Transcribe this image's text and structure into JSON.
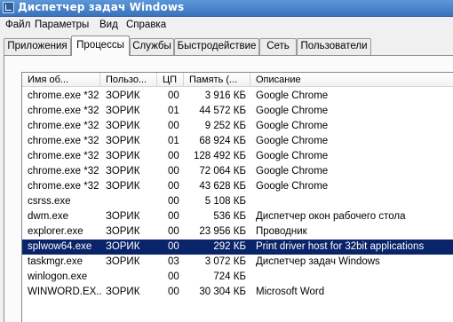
{
  "window": {
    "title": "Диспетчер задач Windows"
  },
  "menu": [
    "Файл",
    "Параметры",
    "Вид",
    "Справка"
  ],
  "tabs": [
    {
      "label": "Приложения",
      "active": false
    },
    {
      "label": "Процессы",
      "active": true
    },
    {
      "label": "Службы",
      "active": false
    },
    {
      "label": "Быстродействие",
      "active": false
    },
    {
      "label": "Сеть",
      "active": false
    },
    {
      "label": "Пользователи",
      "active": false
    }
  ],
  "columns": [
    "Имя об...",
    "Пользо...",
    "ЦП",
    "Память (...",
    "Описание"
  ],
  "processes": [
    {
      "name": "chrome.exe *32",
      "user": "ЗОРИК",
      "cpu": "00",
      "memory": "3 916 КБ",
      "desc": "Google Chrome"
    },
    {
      "name": "chrome.exe *32",
      "user": "ЗОРИК",
      "cpu": "01",
      "memory": "44 572 КБ",
      "desc": "Google Chrome"
    },
    {
      "name": "chrome.exe *32",
      "user": "ЗОРИК",
      "cpu": "00",
      "memory": "9 252 КБ",
      "desc": "Google Chrome"
    },
    {
      "name": "chrome.exe *32",
      "user": "ЗОРИК",
      "cpu": "01",
      "memory": "68 924 КБ",
      "desc": "Google Chrome"
    },
    {
      "name": "chrome.exe *32",
      "user": "ЗОРИК",
      "cpu": "00",
      "memory": "128 492 КБ",
      "desc": "Google Chrome"
    },
    {
      "name": "chrome.exe *32",
      "user": "ЗОРИК",
      "cpu": "00",
      "memory": "72 064 КБ",
      "desc": "Google Chrome"
    },
    {
      "name": "chrome.exe *32",
      "user": "ЗОРИК",
      "cpu": "00",
      "memory": "43 628 КБ",
      "desc": "Google Chrome"
    },
    {
      "name": "csrss.exe",
      "user": "",
      "cpu": "00",
      "memory": "5 108 КБ",
      "desc": ""
    },
    {
      "name": "dwm.exe",
      "user": "ЗОРИК",
      "cpu": "00",
      "memory": "536 КБ",
      "desc": "Диспетчер окон рабочего стола"
    },
    {
      "name": "explorer.exe",
      "user": "ЗОРИК",
      "cpu": "00",
      "memory": "23 956 КБ",
      "desc": "Проводник"
    },
    {
      "name": "splwow64.exe",
      "user": "ЗОРИК",
      "cpu": "00",
      "memory": "292 КБ",
      "desc": "Print driver host for 32bit applications",
      "selected": true
    },
    {
      "name": "taskmgr.exe",
      "user": "ЗОРИК",
      "cpu": "03",
      "memory": "3 072 КБ",
      "desc": "Диспетчер задач Windows"
    },
    {
      "name": "winlogon.exe",
      "user": "",
      "cpu": "00",
      "memory": "724 КБ",
      "desc": ""
    },
    {
      "name": "WINWORD.EX...",
      "user": "ЗОРИК",
      "cpu": "00",
      "memory": "30 304 КБ",
      "desc": "Microsoft Word"
    }
  ]
}
